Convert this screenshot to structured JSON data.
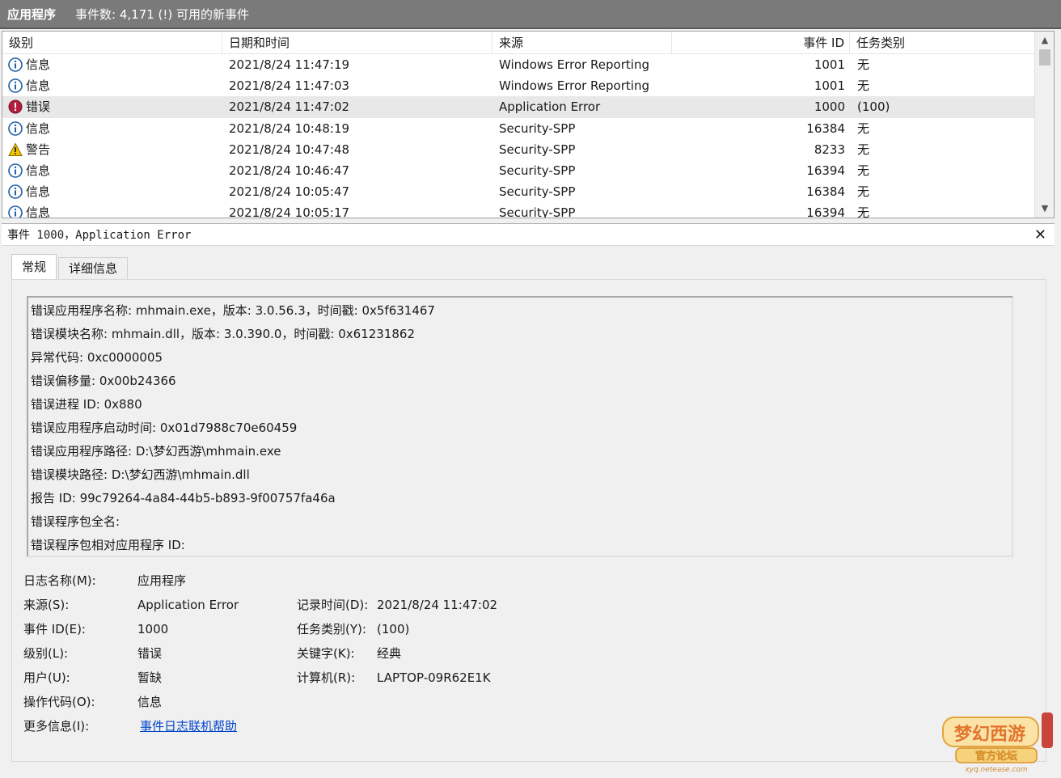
{
  "titlebar": {
    "log_name": "应用程序",
    "summary": "事件数: 4,171 (!) 可用的新事件"
  },
  "columns": {
    "level": "级别",
    "datetime": "日期和时间",
    "source": "来源",
    "event_id": "事件 ID",
    "task": "任务类别"
  },
  "events": [
    {
      "icon": "info-icon",
      "level": "信息",
      "datetime": "2021/8/24 11:47:19",
      "source": "Windows Error Reporting",
      "event_id": "1001",
      "task": "无"
    },
    {
      "icon": "info-icon",
      "level": "信息",
      "datetime": "2021/8/24 11:47:03",
      "source": "Windows Error Reporting",
      "event_id": "1001",
      "task": "无"
    },
    {
      "icon": "error-icon",
      "level": "错误",
      "datetime": "2021/8/24 11:47:02",
      "source": "Application Error",
      "event_id": "1000",
      "task": "(100)"
    },
    {
      "icon": "info-icon",
      "level": "信息",
      "datetime": "2021/8/24 10:48:19",
      "source": "Security-SPP",
      "event_id": "16384",
      "task": "无"
    },
    {
      "icon": "warning-icon",
      "level": "警告",
      "datetime": "2021/8/24 10:47:48",
      "source": "Security-SPP",
      "event_id": "8233",
      "task": "无"
    },
    {
      "icon": "info-icon",
      "level": "信息",
      "datetime": "2021/8/24 10:46:47",
      "source": "Security-SPP",
      "event_id": "16394",
      "task": "无"
    },
    {
      "icon": "info-icon",
      "level": "信息",
      "datetime": "2021/8/24 10:05:47",
      "source": "Security-SPP",
      "event_id": "16384",
      "task": "无"
    },
    {
      "icon": "info-icon",
      "level": "信息",
      "datetime": "2021/8/24 10:05:17",
      "source": "Security-SPP",
      "event_id": "16394",
      "task": "无"
    }
  ],
  "selected_index": 2,
  "detail": {
    "title": "事件 1000，Application Error",
    "tabs": [
      "常规",
      "详细信息"
    ],
    "active_tab": 0,
    "description": [
      "错误应用程序名称: mhmain.exe，版本: 3.0.56.3，时间戳: 0x5f631467",
      "错误模块名称: mhmain.dll，版本: 3.0.390.0，时间戳: 0x61231862",
      "异常代码: 0xc0000005",
      "错误偏移量: 0x00b24366",
      "错误进程 ID: 0x880",
      "错误应用程序启动时间: 0x01d7988c70e60459",
      "错误应用程序路径: D:\\梦幻西游\\mhmain.exe",
      "错误模块路径: D:\\梦幻西游\\mhmain.dll",
      "报告 ID: 99c79264-4a84-44b5-b893-9f00757fa46a",
      "错误程序包全名:",
      "错误程序包相对应用程序 ID:"
    ],
    "props": {
      "log_name_label": "日志名称(M):",
      "log_name": "应用程序",
      "source_label": "来源(S):",
      "source": "Application Error",
      "logged_label": "记录时间(D):",
      "logged": "2021/8/24 11:47:02",
      "event_id_label": "事件 ID(E):",
      "event_id": "1000",
      "task_label": "任务类别(Y):",
      "task": "(100)",
      "level_label": "级别(L):",
      "level": "错误",
      "keywords_label": "关键字(K):",
      "keywords": "经典",
      "user_label": "用户(U):",
      "user": "暂缺",
      "computer_label": "计算机(R):",
      "computer": "LAPTOP-09R62E1K",
      "opcode_label": "操作代码(O):",
      "opcode": "信息",
      "more_info_label": "更多信息(I):",
      "more_info_link": "事件日志联机帮助"
    }
  },
  "watermark": {
    "logo_text": "梦幻西游",
    "sub_text": "官方论坛",
    "url": "xyq.netease.com"
  },
  "colors": {
    "titlebar": "#7a7a7a",
    "info": "#1f5fa8",
    "error": "#b01e3c",
    "warning": "#f2c400",
    "link": "#0044cc"
  }
}
